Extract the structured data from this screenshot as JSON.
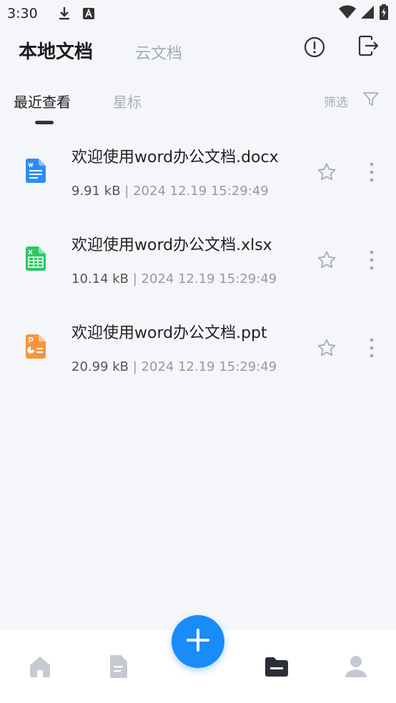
{
  "status_bar": {
    "time": "3:30",
    "icons": [
      "download-icon",
      "keyboard-a-icon",
      "wifi-icon",
      "cell-signal-icon",
      "battery-charging-icon"
    ]
  },
  "header": {
    "local_tab": "本地文档",
    "cloud_tab": "云文档",
    "icons": [
      "info-icon",
      "export-icon"
    ]
  },
  "subtabs": {
    "recent": "最近查看",
    "starred": "星标",
    "filter": "筛选"
  },
  "files": [
    {
      "name": "欢迎使用word办公文档.docx",
      "size": "9.91 kB",
      "separator": " | ",
      "date": "2024 12.19 15:29:49",
      "type": "word",
      "color": "#2f8cf5"
    },
    {
      "name": "欢迎使用word办公文档.xlsx",
      "size": "10.14 kB",
      "separator": " | ",
      "date": "2024 12.19 15:29:49",
      "type": "excel",
      "color": "#2ec766"
    },
    {
      "name": "欢迎使用word办公文档.ppt",
      "size": "20.99 kB",
      "separator": " | ",
      "date": "2024 12.19 15:29:49",
      "type": "powerpoint",
      "color": "#f7953b"
    }
  ],
  "bottom_nav": {
    "items": [
      "home-icon",
      "document-icon",
      "add-icon",
      "folder-icon",
      "profile-icon"
    ],
    "active": "folder-icon"
  },
  "colors": {
    "accent": "#1a8cf8",
    "background": "#f4f6fa"
  }
}
